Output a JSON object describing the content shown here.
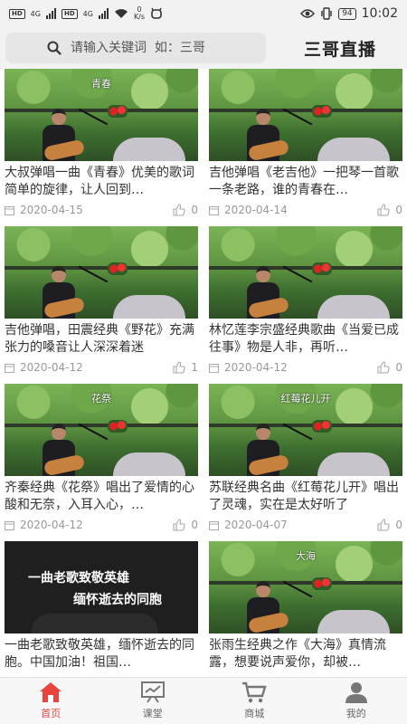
{
  "status_bar": {
    "net_left": "4G",
    "net_right": "4G",
    "speed_value": "0",
    "speed_unit": "K/s",
    "battery": "94",
    "time": "10:02"
  },
  "header": {
    "search_placeholder": "请输入关键词  如：三哥",
    "brand": "三哥直播"
  },
  "videos": [
    {
      "title": "大叔弹唱一曲《青春》优美的歌词简单的旋律，让人回到…",
      "date": "2020-04-15",
      "likes": "0",
      "caption": "青春"
    },
    {
      "title": "吉他弹唱《老吉他》一把琴一首歌一条老路，谁的青春在…",
      "date": "2020-04-14",
      "likes": "0",
      "caption": ""
    },
    {
      "title": "吉他弹唱，田震经典《野花》充满张力的嗓音让人深深着迷",
      "date": "2020-04-12",
      "likes": "1",
      "caption": ""
    },
    {
      "title": "林忆莲李宗盛经典歌曲《当爱已成往事》物是人非，再听…",
      "date": "2020-04-12",
      "likes": "0",
      "caption": ""
    },
    {
      "title": "齐秦经典《花祭》唱出了爱情的心酸和无奈，入耳入心，…",
      "date": "2020-04-12",
      "likes": "0",
      "caption": "花祭"
    },
    {
      "title": "苏联经典名曲《红莓花儿开》唱出了灵魂，实在是太好听了",
      "date": "2020-04-07",
      "likes": "0",
      "caption": "红莓花儿开"
    },
    {
      "title": "一曲老歌致敬英雄，缅怀逝去的同胞。中国加油！祖国…",
      "date": "",
      "likes": "",
      "caption": "",
      "overlay1": "一曲老歌致敬英雄",
      "overlay2": "缅怀逝去的同胞"
    },
    {
      "title": "张雨生经典之作《大海》真情流露，想要说声爱你，却被…",
      "date": "",
      "likes": "",
      "caption": "大海"
    }
  ],
  "tabs": [
    {
      "label": "首页",
      "icon": "home-icon",
      "active": true
    },
    {
      "label": "课堂",
      "icon": "classroom-icon",
      "active": false
    },
    {
      "label": "商城",
      "icon": "cart-icon",
      "active": false
    },
    {
      "label": "我的",
      "icon": "profile-icon",
      "active": false
    }
  ],
  "colors": {
    "accent": "#e8453c",
    "header_bg": "#f2f2f2",
    "meta_text": "#999999"
  }
}
